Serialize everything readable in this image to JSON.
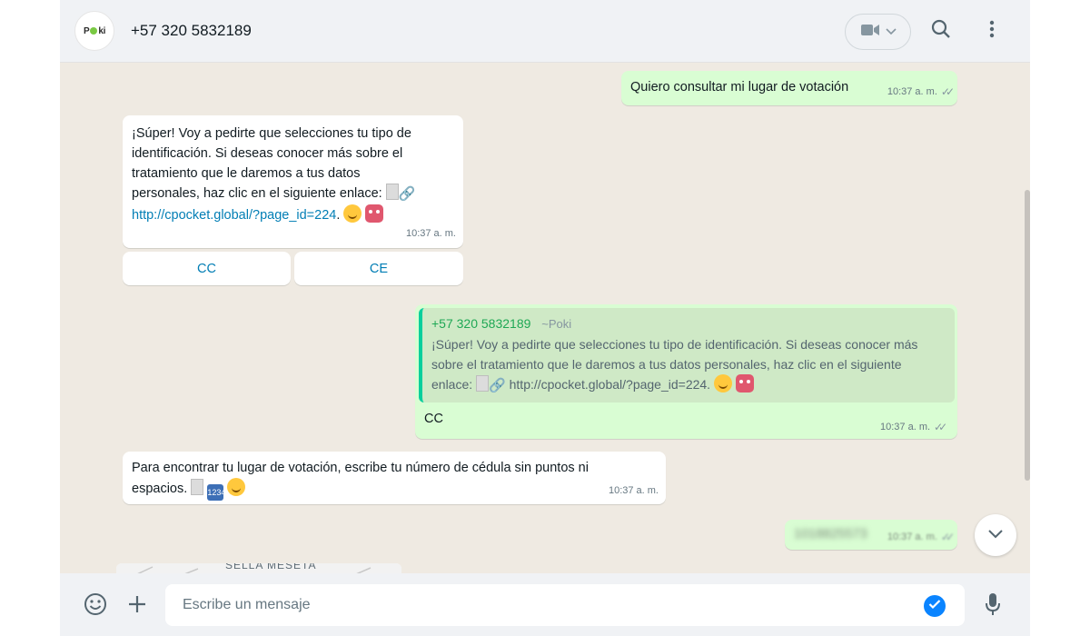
{
  "header": {
    "avatar_logo": "Poki",
    "contact": "+57 320 5832189"
  },
  "messages": {
    "m1": {
      "text": "Quiero consultar mi lugar de votación",
      "time": "10:37 a. m."
    },
    "m2": {
      "line1": "¡Súper! Voy a pedirte que selecciones tu tipo de",
      "line2": "identificación. Si deseas conocer más sobre el",
      "line3": "tratamiento que le daremos a tus datos",
      "line4": "personales, haz clic en el siguiente enlace:",
      "link": "http://cpocket.global/?page_id=224",
      "after_link": ".",
      "time": "10:37 a. m."
    },
    "options": {
      "opt1": "CC",
      "opt2": "CE"
    },
    "m3": {
      "quote_author": "+57 320 5832189",
      "quote_pushname": "~Poki",
      "quote_line1": "¡Súper! Voy a pedirte que selecciones tu tipo de identificación. Si deseas conocer más",
      "quote_line2": "sobre el tratamiento que le daremos a tus datos personales, haz clic en el siguiente",
      "quote_line3_prefix": "enlace:",
      "quote_line3_link": "http://cpocket.global/?page_id=224.",
      "text": "CC",
      "time": "10:37 a. m."
    },
    "m4": {
      "line1": "Para encontrar tu lugar de votación, escribe tu número de cédula sin puntos ni",
      "line2": "espacios.",
      "time": "10:37 a. m."
    },
    "m5": {
      "text": "1018825573",
      "time": "10:37 a. m."
    },
    "partial": {
      "text": "SELLA MESETA"
    }
  },
  "footer": {
    "placeholder": "Escribe un mensaje"
  },
  "colors": {
    "chat_bg": "#efeae2",
    "outgoing": "#d9fdd3",
    "incoming": "#ffffff",
    "link": "#027eb5",
    "quote_accent": "#06cf9c"
  },
  "icons": [
    "video-call-icon",
    "chevron-down-icon",
    "search-icon",
    "menu-dots-icon",
    "emoji-icon",
    "plus-icon",
    "verified-check-icon",
    "microphone-icon",
    "scroll-down-chevron-icon"
  ]
}
